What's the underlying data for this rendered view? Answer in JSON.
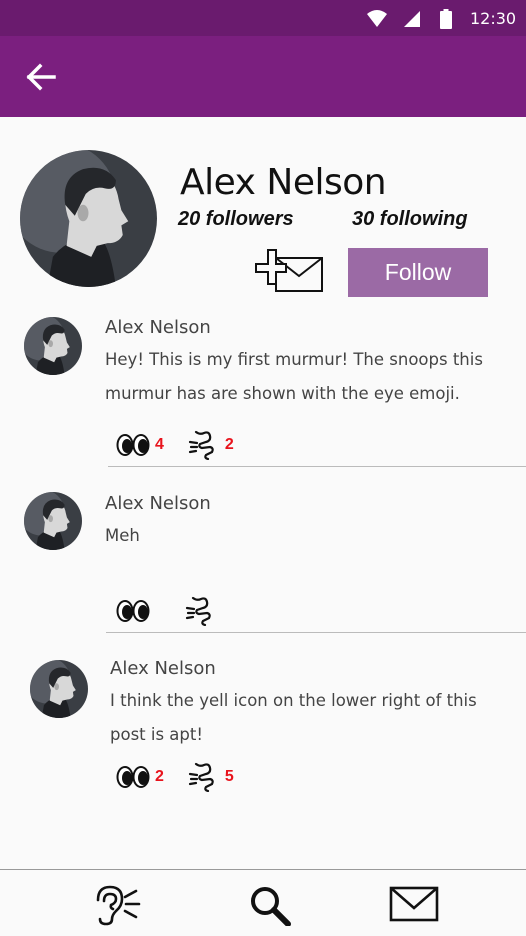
{
  "status_bar": {
    "time": "12:30"
  },
  "profile": {
    "name": "Alex Nelson",
    "followers": "20 followers",
    "following": "30 following",
    "follow_label": "Follow"
  },
  "posts": [
    {
      "author": "Alex Nelson",
      "text": "Hey! This is my first murmur! The snoops this murmur has are shown with the eye emoji.",
      "snoops": "4",
      "yells": "2"
    },
    {
      "author": "Alex Nelson",
      "text": "Meh",
      "snoops": "",
      "yells": ""
    },
    {
      "author": "Alex Nelson",
      "text": "I think the yell icon on the lower right of this post is apt!",
      "snoops": "2",
      "yells": "5"
    }
  ],
  "icons": {
    "back": "arrow-left-icon",
    "add_message": "add-message-icon",
    "snoop": "eyes-icon",
    "yell": "yell-icon",
    "nav_listen": "ear-icon",
    "nav_search": "search-icon",
    "nav_messages": "envelope-icon"
  },
  "colors": {
    "status_bar": "#6a1b6e",
    "app_bar": "#7b1f7f",
    "follow_button": "#9b6aa5",
    "count": "#e8131c"
  }
}
